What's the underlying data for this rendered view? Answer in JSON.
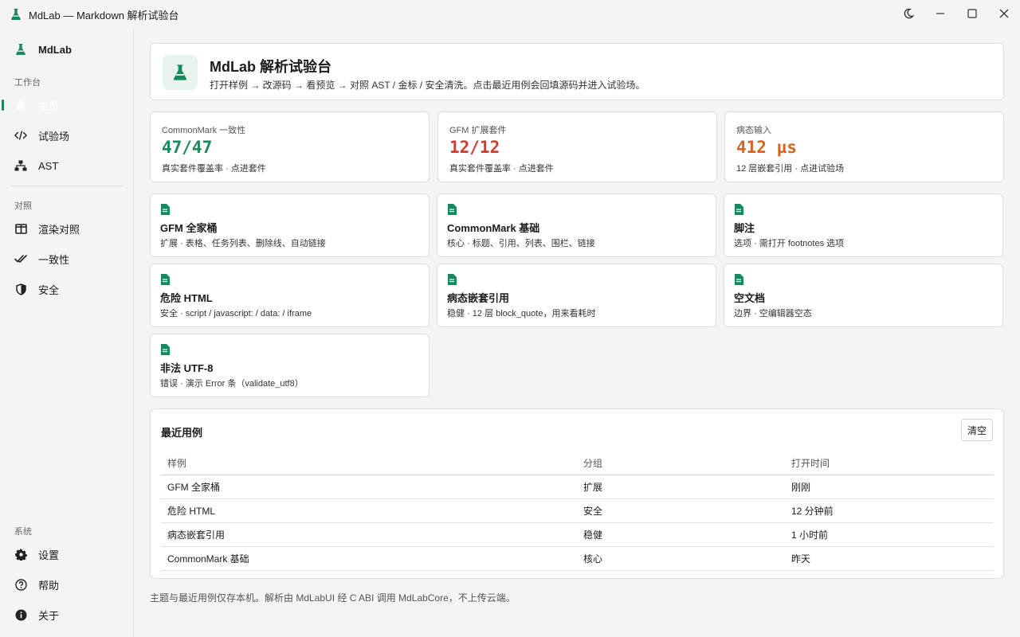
{
  "window": {
    "title": "MdLab — Markdown 解析试验台",
    "controls": [
      "theme-toggle",
      "minimize",
      "maximize",
      "close"
    ]
  },
  "sidebar": {
    "brand": "MdLab",
    "sections": [
      {
        "label": "工作台",
        "items": [
          {
            "label": "主页",
            "icon": "home-icon",
            "active": true
          },
          {
            "label": "试验场",
            "icon": "code-icon"
          },
          {
            "label": "AST",
            "icon": "tree-icon"
          }
        ]
      },
      {
        "label": "对照",
        "items": [
          {
            "label": "渲染对照",
            "icon": "columns-icon"
          },
          {
            "label": "一致性",
            "icon": "check-all-icon"
          },
          {
            "label": "安全",
            "icon": "shield-icon"
          }
        ]
      },
      {
        "label": "系统",
        "items": [
          {
            "label": "设置",
            "icon": "gear-icon"
          },
          {
            "label": "帮助",
            "icon": "help-icon"
          },
          {
            "label": "关于",
            "icon": "info-icon"
          }
        ]
      }
    ]
  },
  "hero": {
    "title": "MdLab 解析试验台",
    "subtitle": "打开样例 → 改源码 → 看预览 → 对照 AST / 金标 / 安全清洗。点击最近用例会回填源码并进入试验场。"
  },
  "stats": [
    {
      "label": "CommonMark 一致性",
      "value": "47/47",
      "note": "真实套件覆盖率 · 点进套件",
      "color": "#1a8a5a"
    },
    {
      "label": "GFM 扩展套件",
      "value": "12/12",
      "note": "真实套件覆盖率 · 点进套件",
      "color": "#d23a34"
    },
    {
      "label": "病态输入",
      "value": "412 µs",
      "note": "12 层嵌套引用 · 点进试验场",
      "color": "#d9641e"
    }
  ],
  "samples": [
    {
      "name": "GFM 全家桶",
      "desc": "扩展 · 表格、任务列表、删除线、自动链接"
    },
    {
      "name": "CommonMark 基础",
      "desc": "核心 · 标题、引用、列表、围栏、链接"
    },
    {
      "name": "脚注",
      "desc": "选项 · 需打开 footnotes 选项"
    },
    {
      "name": "危险 HTML",
      "desc": "安全 · script / javascript: / data: / iframe"
    },
    {
      "name": "病态嵌套引用",
      "desc": "稳健 · 12 层 block_quote，用来看耗时"
    },
    {
      "name": "空文档",
      "desc": "边界 · 空编辑器空态"
    },
    {
      "name": "非法 UTF-8",
      "desc": "错误 · 演示 Error 条（validate_utf8）"
    }
  ],
  "recent": {
    "title": "最近用例",
    "clear_label": "清空",
    "columns": [
      "样例",
      "分组",
      "打开时间"
    ],
    "rows": [
      [
        "GFM 全家桶",
        "扩展",
        "刚刚"
      ],
      [
        "危险 HTML",
        "安全",
        "12 分钟前"
      ],
      [
        "病态嵌套引用",
        "稳健",
        "1 小时前"
      ],
      [
        "CommonMark 基础",
        "核心",
        "昨天"
      ]
    ]
  },
  "footer": "主题与最近用例仅存本机。解析由 MdLabUI 经 C ABI 调用 MdLabCore，不上传云端。",
  "colors": {
    "accent": "#178a5d",
    "accent_bg": "#e6f4ed"
  }
}
